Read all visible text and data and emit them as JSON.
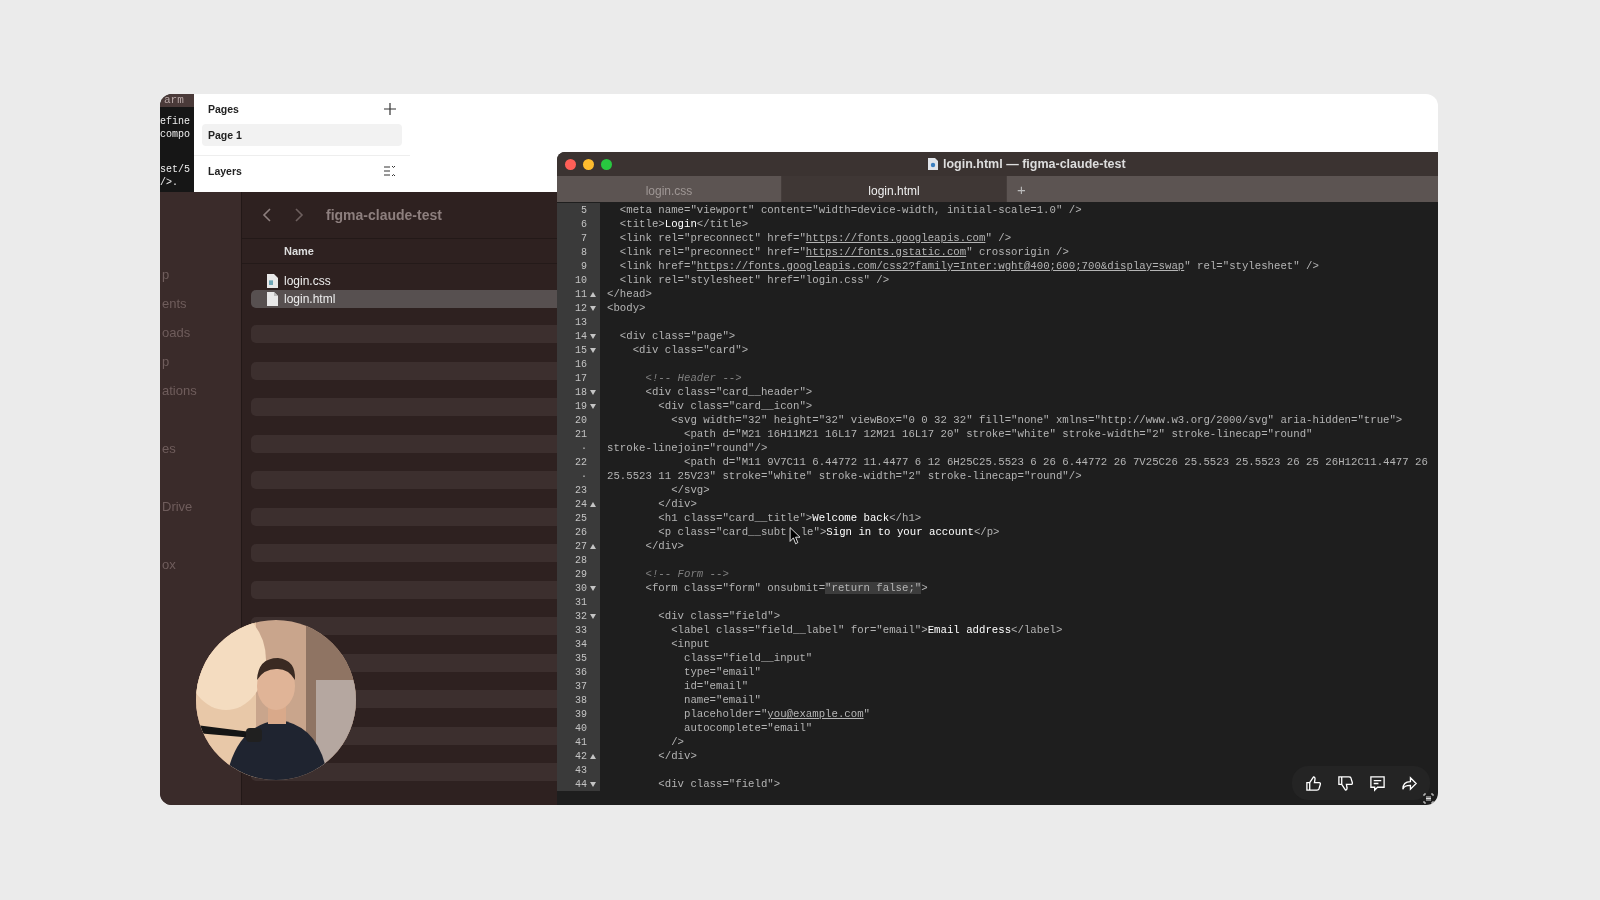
{
  "terminal": {
    "title": "arm",
    "output_blocks": [
      [
        "efine",
        "compo"
      ],
      [
        "set/5",
        "/>."
      ]
    ]
  },
  "figma_panel": {
    "pages_title": "Pages",
    "pages": [
      {
        "label": "Page 1",
        "selected": true
      }
    ],
    "layers_title": "Layers"
  },
  "finder": {
    "title": "figma-claude-test",
    "sidebar_sections": [
      [
        "p",
        "ents",
        "oads",
        "p",
        "ations"
      ],
      [
        "es"
      ],
      [
        "Drive"
      ],
      [
        "ox"
      ]
    ],
    "column_header": "Name",
    "files": [
      {
        "name": "login.css",
        "kind": "css",
        "selected": false
      },
      {
        "name": "login.html",
        "kind": "html",
        "selected": true
      }
    ]
  },
  "editor": {
    "title": "login.html — figma-claude-test",
    "tabs": [
      {
        "label": "login.css",
        "selected": false
      },
      {
        "label": "login.html",
        "selected": true
      }
    ],
    "new_tab": "+",
    "lines": [
      {
        "number": "5",
        "kind": "plain",
        "text": "  <meta name=\"viewport\" content=\"width=device-width, initial-scale=1.0\" />"
      },
      {
        "number": "6",
        "kind": "plain",
        "parts": [
          {
            "text": "  <title>",
            "kind": "tag"
          },
          {
            "text": "Login",
            "kind": "content"
          },
          {
            "text": "</title>",
            "kind": "tag"
          }
        ]
      },
      {
        "number": "7",
        "kind": "plain",
        "parts": [
          {
            "text": "  <link rel=\"preconnect\" href=\"",
            "kind": "tag"
          },
          {
            "text": "https://fonts.googleapis.com",
            "kind": "url"
          },
          {
            "text": "\" />",
            "kind": "tag"
          }
        ]
      },
      {
        "number": "8",
        "kind": "plain",
        "parts": [
          {
            "text": "  <link rel=\"preconnect\" href=\"",
            "kind": "tag"
          },
          {
            "text": "https://fonts.gstatic.com",
            "kind": "url"
          },
          {
            "text": "\" crossorigin />",
            "kind": "tag"
          }
        ]
      },
      {
        "number": "9",
        "kind": "plain",
        "parts": [
          {
            "text": "  <link href=\"",
            "kind": "tag"
          },
          {
            "text": "https://fonts.googleapis.com/css2?family=Inter:wght@400;600;700&display=swap",
            "kind": "url"
          },
          {
            "text": "\" rel=\"stylesheet\" />",
            "kind": "tag"
          }
        ]
      },
      {
        "number": "10",
        "kind": "plain",
        "text": "  <link rel=\"stylesheet\" href=\"login.css\" />"
      },
      {
        "number": "11",
        "kind": "fold-end",
        "text": "</head>"
      },
      {
        "number": "12",
        "kind": "fold-start",
        "text": "<body>"
      },
      {
        "number": "13",
        "kind": "plain"
      },
      {
        "number": "14",
        "kind": "fold-start",
        "text": "  <div class=\"page\">"
      },
      {
        "number": "15",
        "kind": "fold-start",
        "text": "    <div class=\"card\">"
      },
      {
        "number": "16",
        "kind": "plain"
      },
      {
        "number": "17",
        "kind": "plain",
        "parts": [
          {
            "text": "      <!-- Header -->",
            "kind": "comment"
          }
        ]
      },
      {
        "number": "18",
        "kind": "fold-start",
        "text": "      <div class=\"card__header\">"
      },
      {
        "number": "19",
        "kind": "fold-start",
        "text": "        <div class=\"card__icon\">"
      },
      {
        "number": "20",
        "kind": "plain",
        "text": "          <svg width=\"32\" height=\"32\" viewBox=\"0 0 32 32\" fill=\"none\" xmlns=\"http://www.w3.org/2000/svg\" aria-hidden=\"true\">"
      },
      {
        "number": "21",
        "kind": "plain",
        "text": "            <path d=\"M21 16H11M21 16L17 12M21 16L17 20\" stroke=\"white\" stroke-width=\"2\" stroke-linecap=\"round\""
      },
      {
        "number": "·",
        "kind": "plain",
        "text": "stroke-linejoin=\"round\"/>"
      },
      {
        "number": "22",
        "kind": "plain",
        "text": "            <path d=\"M11 9V7C11 6.44772 11.4477 6 12 6H25C25.5523 6 26 6.44772 26 7V25C26 25.5523 25.5523 26 25 26H12C11.4477 26"
      },
      {
        "number": "·",
        "kind": "plain",
        "text": "25.5523 11 25V23\" stroke=\"white\" stroke-width=\"2\" stroke-linecap=\"round\"/>"
      },
      {
        "number": "23",
        "kind": "plain",
        "text": "          </svg>"
      },
      {
        "number": "24",
        "kind": "fold-end",
        "text": "        </div>"
      },
      {
        "number": "25",
        "kind": "plain",
        "parts": [
          {
            "text": "        <h1 class=\"card__title\">",
            "kind": "tag"
          },
          {
            "text": "Welcome back",
            "kind": "content"
          },
          {
            "text": "</h1>",
            "kind": "tag"
          }
        ]
      },
      {
        "number": "26",
        "kind": "plain",
        "parts": [
          {
            "text": "        <p class=\"card__subt",
            "kind": "tag"
          },
          {
            "text": "le\">",
            "kind": "tag-after-gap"
          },
          {
            "text": "Sign in to your account",
            "kind": "content"
          },
          {
            "text": "</p>",
            "kind": "tag"
          }
        ]
      },
      {
        "number": "27",
        "kind": "fold-end",
        "text": "      </div>"
      },
      {
        "number": "28",
        "kind": "plain"
      },
      {
        "number": "29",
        "kind": "plain",
        "parts": [
          {
            "text": "      <!-- Form -->",
            "kind": "comment"
          }
        ]
      },
      {
        "number": "30",
        "kind": "fold-start",
        "parts": [
          {
            "text": "      <form class=\"form\" onsubmit=",
            "kind": "tag"
          },
          {
            "text": "\"return false;\"",
            "kind": "selected"
          },
          {
            "text": ">",
            "kind": "tag"
          }
        ]
      },
      {
        "number": "31",
        "kind": "plain"
      },
      {
        "number": "32",
        "kind": "fold-start",
        "text": "        <div class=\"field\">"
      },
      {
        "number": "33",
        "kind": "plain",
        "parts": [
          {
            "text": "          <label class=\"field__label\" for=\"email\">",
            "kind": "tag"
          },
          {
            "text": "Email address",
            "kind": "content"
          },
          {
            "text": "</label>",
            "kind": "tag"
          }
        ]
      },
      {
        "number": "34",
        "kind": "plain",
        "text": "          <input"
      },
      {
        "number": "35",
        "kind": "plain",
        "text": "            class=\"field__input\""
      },
      {
        "number": "36",
        "kind": "plain",
        "text": "            type=\"email\""
      },
      {
        "number": "37",
        "kind": "plain",
        "text": "            id=\"email\""
      },
      {
        "number": "38",
        "kind": "plain",
        "text": "            name=\"email\""
      },
      {
        "number": "39",
        "kind": "plain",
        "parts": [
          {
            "text": "            placeholder=\"",
            "kind": "tag"
          },
          {
            "text": "you@example.com",
            "kind": "url"
          },
          {
            "text": "\"",
            "kind": "tag"
          }
        ]
      },
      {
        "number": "40",
        "kind": "plain",
        "text": "            autocomplete=\"email\""
      },
      {
        "number": "41",
        "kind": "plain",
        "text": "          />"
      },
      {
        "number": "42",
        "kind": "fold-end",
        "text": "        </div>"
      },
      {
        "number": "43",
        "kind": "plain"
      },
      {
        "number": "44",
        "kind": "fold-start",
        "text": "        <div class=\"field\">"
      }
    ]
  }
}
